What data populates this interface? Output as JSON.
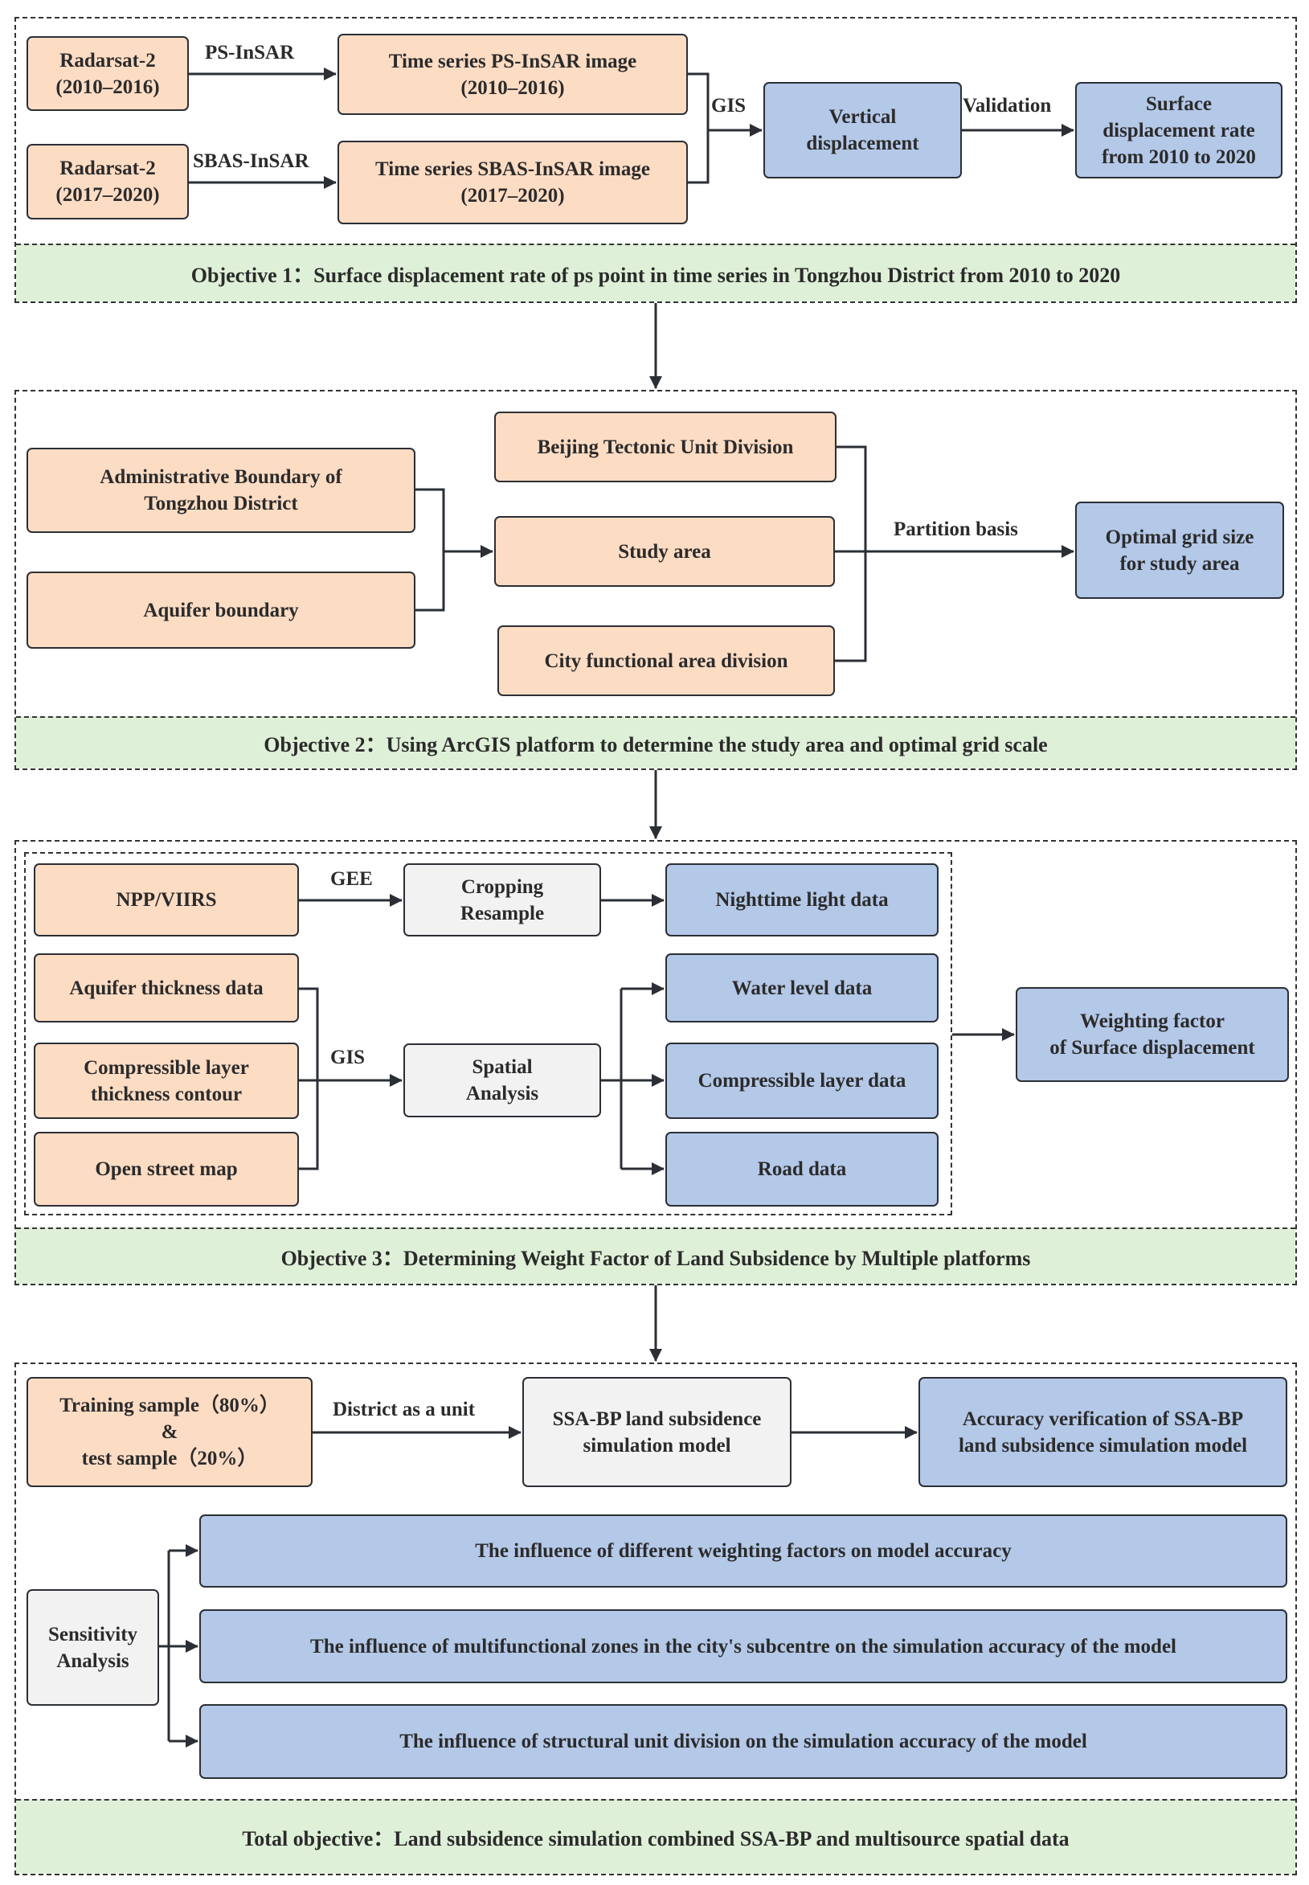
{
  "colors": {
    "input": "#fddcc4",
    "output": "#b4c8e8",
    "process": "#f2f2f2",
    "objective_band": "#dff0d8",
    "stroke": "#2b2f35"
  },
  "section1": {
    "nodes": {
      "radarsat_a": "Radarsat-2\n(2010–2016)",
      "radarsat_b": "Radarsat-2\n(2017–2020)",
      "ts_ps": "Time series PS-InSAR image\n(2010–2016)",
      "ts_sbas": "Time series SBAS-InSAR image\n(2017–2020)",
      "vertical": "Vertical\ndisplacement",
      "surface_rate": "Surface\ndisplacement rate\nfrom 2010 to 2020"
    },
    "edges": {
      "ps_insar": "PS-InSAR",
      "sbas_insar": "SBAS-InSAR",
      "gis": "GIS",
      "validation": "Validation"
    },
    "objective": "Objective 1：Surface displacement rate of ps point in time series in Tongzhou District from 2010 to 2020"
  },
  "section2": {
    "nodes": {
      "admin_boundary": "Administrative Boundary of\nTongzhou District",
      "aquifer_boundary": "Aquifer boundary",
      "tectonic": "Beijing Tectonic Unit Division",
      "study_area": "Study area",
      "city_functional": "City functional area division",
      "optimal_grid": "Optimal grid size\nfor study area"
    },
    "edges": {
      "partition": "Partition basis"
    },
    "objective": "Objective 2：Using ArcGIS platform to determine the study area and optimal grid scale"
  },
  "section3": {
    "nodes": {
      "npp": "NPP/VIIRS",
      "cropping": "Cropping\nResample",
      "nighttime": "Nighttime light data",
      "aquifer_thickness": "Aquifer thickness data",
      "compressible_contour": "Compressible layer\nthickness contour",
      "osm": "Open street map",
      "spatial": "Spatial\nAnalysis",
      "water_level": "Water level data",
      "compressible_data": "Compressible layer data",
      "road": "Road data",
      "weighting": "Weighting factor\nof Surface displacement"
    },
    "edges": {
      "gee": "GEE",
      "gis": "GIS"
    },
    "objective": "Objective 3：Determining Weight Factor of Land Subsidence by Multiple platforms"
  },
  "section4": {
    "nodes": {
      "samples": "Training sample（80%）\n&\ntest sample（20%）",
      "ssa_bp": "SSA-BP land subsidence\nsimulation model",
      "accuracy": "Accuracy verification of SSA-BP\nland subsidence simulation model",
      "sensitivity": "Sensitivity\nAnalysis",
      "influence_weighting": "The influence of different weighting factors on model accuracy",
      "influence_zones": "The influence of multifunctional zones in the city's subcentre on the simulation accuracy of the model",
      "influence_structural": "The influence of structural unit division on the simulation accuracy of the model"
    },
    "edges": {
      "district": "District as a unit"
    },
    "objective": "Total objective：Land subsidence simulation combined SSA-BP and multisource spatial data"
  }
}
